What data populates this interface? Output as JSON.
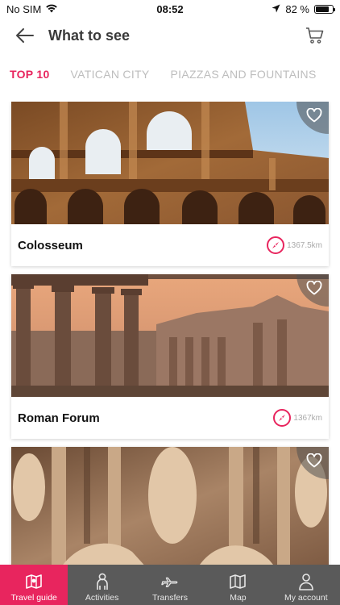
{
  "status_bar": {
    "carrier": "No SIM",
    "time": "08:52",
    "battery_text": "82 %",
    "battery_level": 0.82
  },
  "header": {
    "title": "What to see",
    "back_icon": "arrow-left-icon",
    "cart_icon": "cart-icon"
  },
  "tabs": [
    {
      "label": "TOP 10",
      "active": true
    },
    {
      "label": "VATICAN CITY",
      "active": false
    },
    {
      "label": "PIAZZAS AND FOUNTAINS",
      "active": false
    }
  ],
  "cards": [
    {
      "title": "Colosseum",
      "distance": "1367.5km",
      "image": "colosseum-photo"
    },
    {
      "title": "Roman Forum",
      "distance": "1367km",
      "image": "roman-forum-photo"
    },
    {
      "title": "",
      "distance": "",
      "image": "trevi-fountain-photo"
    }
  ],
  "bottom_nav": [
    {
      "label": "Travel guide",
      "icon": "map-book-icon",
      "active": true
    },
    {
      "label": "Activities",
      "icon": "person-icon",
      "active": false
    },
    {
      "label": "Transfers",
      "icon": "plane-icon",
      "active": false
    },
    {
      "label": "Map",
      "icon": "map-icon",
      "active": false
    },
    {
      "label": "My account",
      "icon": "user-icon",
      "active": false
    }
  ],
  "colors": {
    "accent": "#e8255e",
    "nav_background": "#5a5a5a"
  }
}
